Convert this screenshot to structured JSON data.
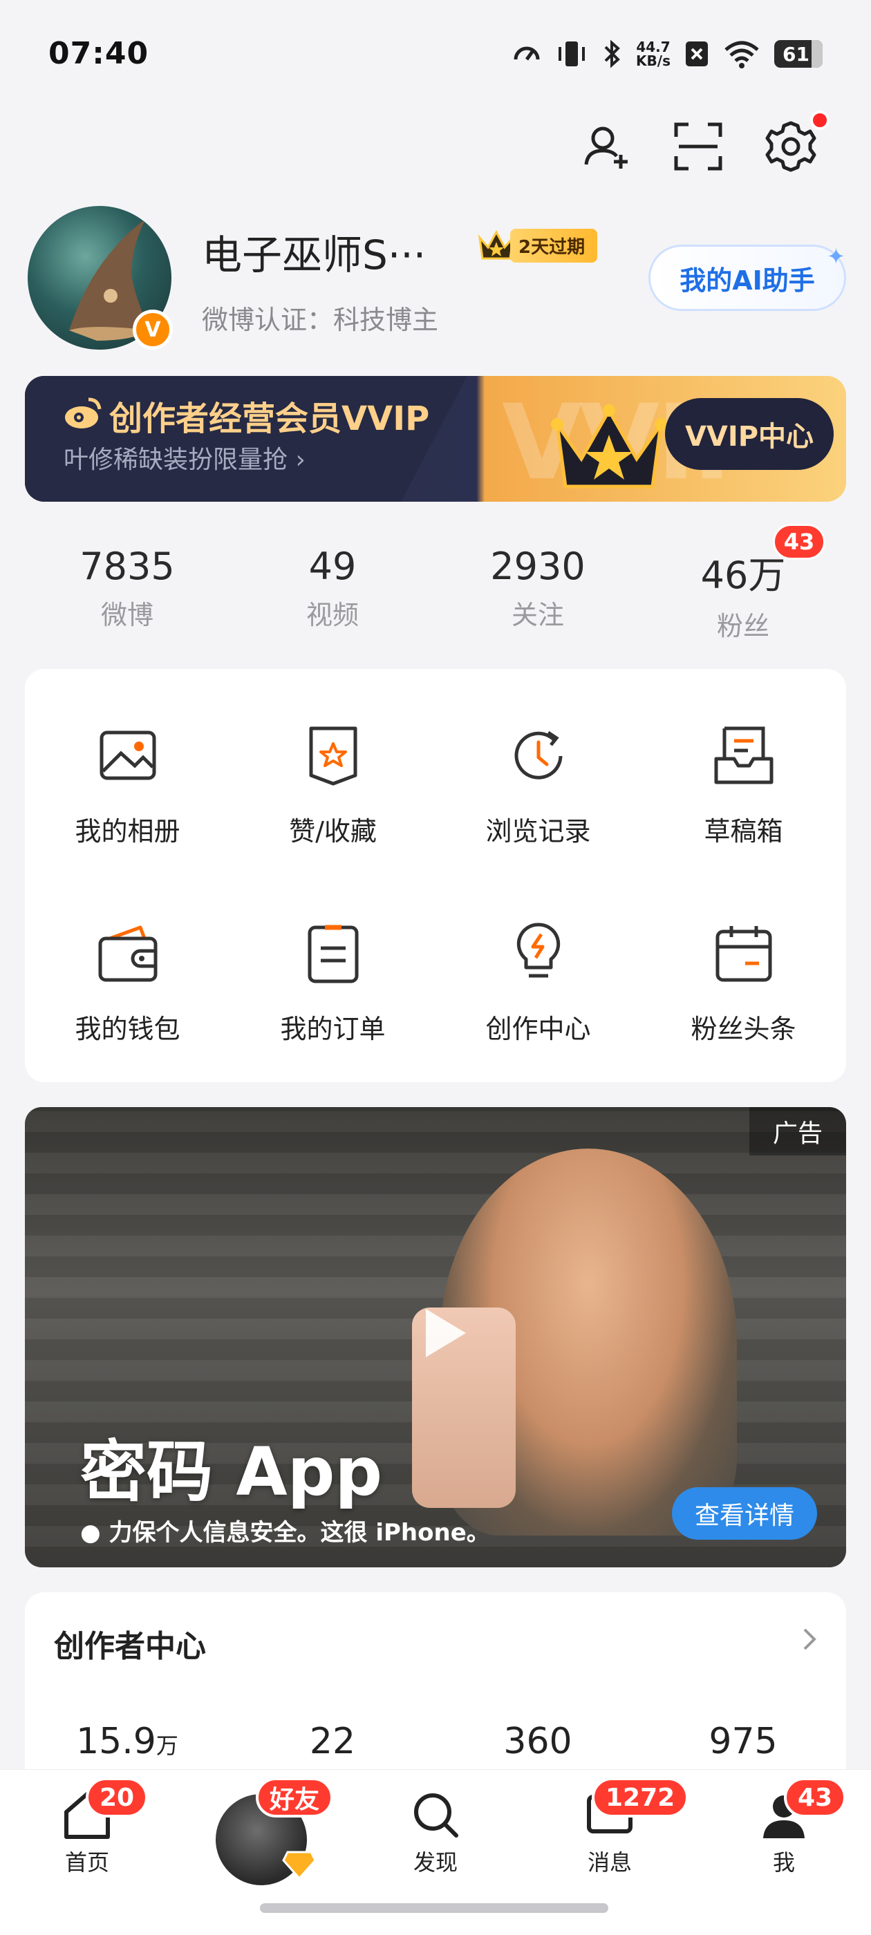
{
  "status_bar": {
    "time": "07:40",
    "net_speed_value": "44.7",
    "net_speed_unit": "KB/s",
    "battery": "61"
  },
  "header": {
    "icons": [
      "add-user-icon",
      "scan-icon",
      "settings-icon"
    ]
  },
  "profile": {
    "username": "电子巫师S···",
    "vip_expiry": "2天过期",
    "verification": "微博认证：科技博主",
    "verified_badge": "V",
    "ai_button_label": "我的AI助手"
  },
  "vvip_banner": {
    "title": "创作者经营会员VVIP",
    "subtitle": "叶修稀缺装扮限量抢 ›",
    "bg_text": "VVIP",
    "button_label": "VVIP中心"
  },
  "stats": [
    {
      "value": "7835",
      "label": "微博"
    },
    {
      "value": "49",
      "label": "视频"
    },
    {
      "value": "2930",
      "label": "关注"
    },
    {
      "value": "46万",
      "label": "粉丝",
      "badge": "43"
    }
  ],
  "feature_grid": [
    {
      "label": "我的相册",
      "icon": "photo-album-icon"
    },
    {
      "label": "赞/收藏",
      "icon": "favorites-icon"
    },
    {
      "label": "浏览记录",
      "icon": "history-icon"
    },
    {
      "label": "草稿箱",
      "icon": "drafts-icon"
    },
    {
      "label": "我的钱包",
      "icon": "wallet-icon"
    },
    {
      "label": "我的订单",
      "icon": "orders-icon"
    },
    {
      "label": "创作中心",
      "icon": "creator-bulb-icon"
    },
    {
      "label": "粉丝头条",
      "icon": "calendar-icon"
    }
  ],
  "ad": {
    "tag": "广告",
    "headline": "密码 App",
    "subtext": "力保个人信息安全。这很 iPhone。",
    "button_label": "查看详情"
  },
  "creator_center": {
    "title": "创作者中心",
    "stats": [
      {
        "value": "15.9",
        "unit": "万"
      },
      {
        "value": "22",
        "unit": ""
      },
      {
        "value": "360",
        "unit": ""
      },
      {
        "value": "975",
        "unit": ""
      }
    ]
  },
  "bottom_nav": [
    {
      "label": "首页",
      "badge": "20",
      "icon": "home-icon"
    },
    {
      "label": "",
      "badge": "好友",
      "icon": "friends-avatar"
    },
    {
      "label": "发现",
      "badge": "",
      "icon": "search-icon"
    },
    {
      "label": "消息",
      "badge": "1272",
      "icon": "message-icon"
    },
    {
      "label": "我",
      "badge": "43",
      "icon": "profile-icon"
    }
  ],
  "colors": {
    "accent_orange": "#ff8c00",
    "badge_red": "#ff3b30",
    "ai_blue": "#1f6fe6",
    "vip_gold": "#ffd08a"
  }
}
